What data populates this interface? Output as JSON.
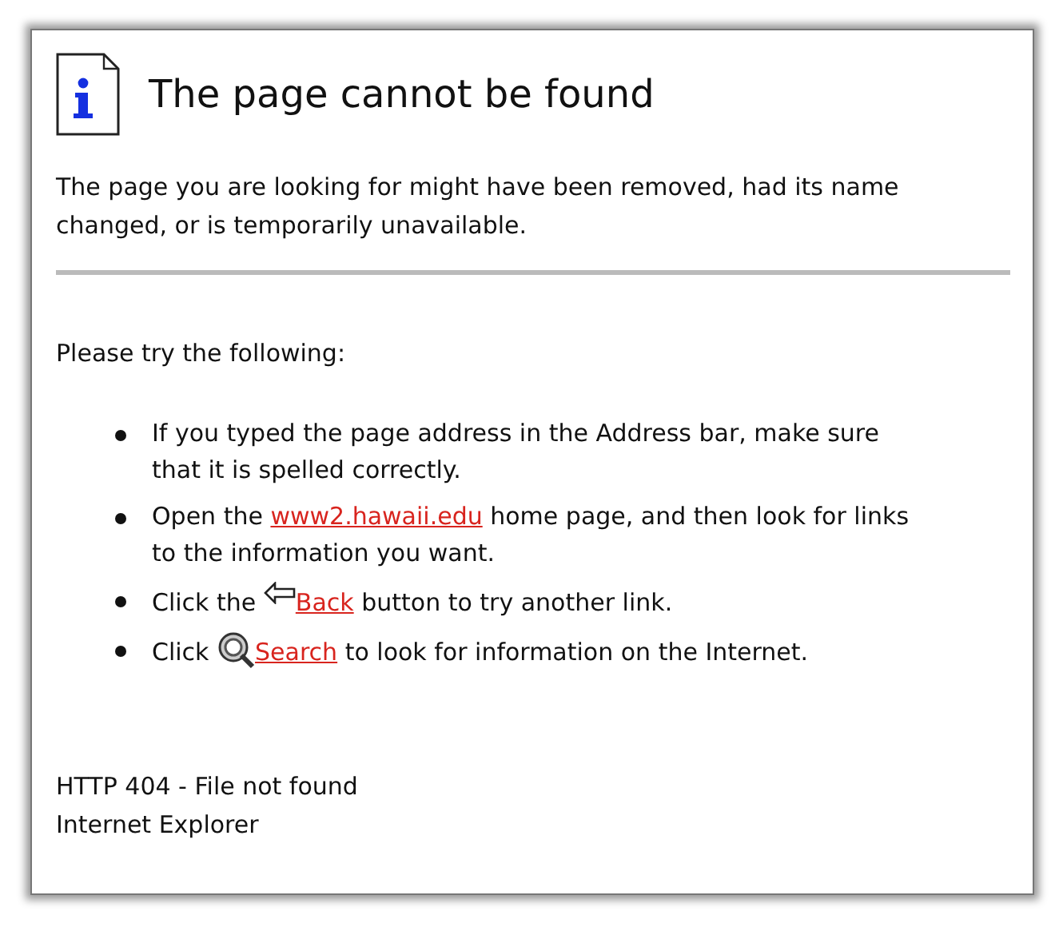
{
  "title": "The page cannot be found",
  "intro": "The page you are looking for might have been removed, had its name changed, or is temporarily unavailable.",
  "prompt": "Please try the following:",
  "suggestions": [
    {
      "parts": [
        {
          "kind": "text",
          "text": "If you typed the page address in the Address bar, make sure that it is spelled correctly."
        }
      ]
    },
    {
      "parts": [
        {
          "kind": "text",
          "text": "Open the "
        },
        {
          "kind": "link",
          "text": "www2.hawaii.edu"
        },
        {
          "kind": "text",
          "text": " home page, and then look for links to the information you want."
        }
      ]
    },
    {
      "parts": [
        {
          "kind": "text",
          "text": "Click the "
        },
        {
          "kind": "backlink",
          "text": "Back"
        },
        {
          "kind": "text",
          "text": " button to try another link."
        }
      ]
    },
    {
      "parts": [
        {
          "kind": "text",
          "text": "Click "
        },
        {
          "kind": "searchlink",
          "text": "Search"
        },
        {
          "kind": "text",
          "text": " to look for information on the Internet."
        }
      ]
    }
  ],
  "footer": [
    "HTTP 404 - File not found",
    "Internet Explorer"
  ]
}
